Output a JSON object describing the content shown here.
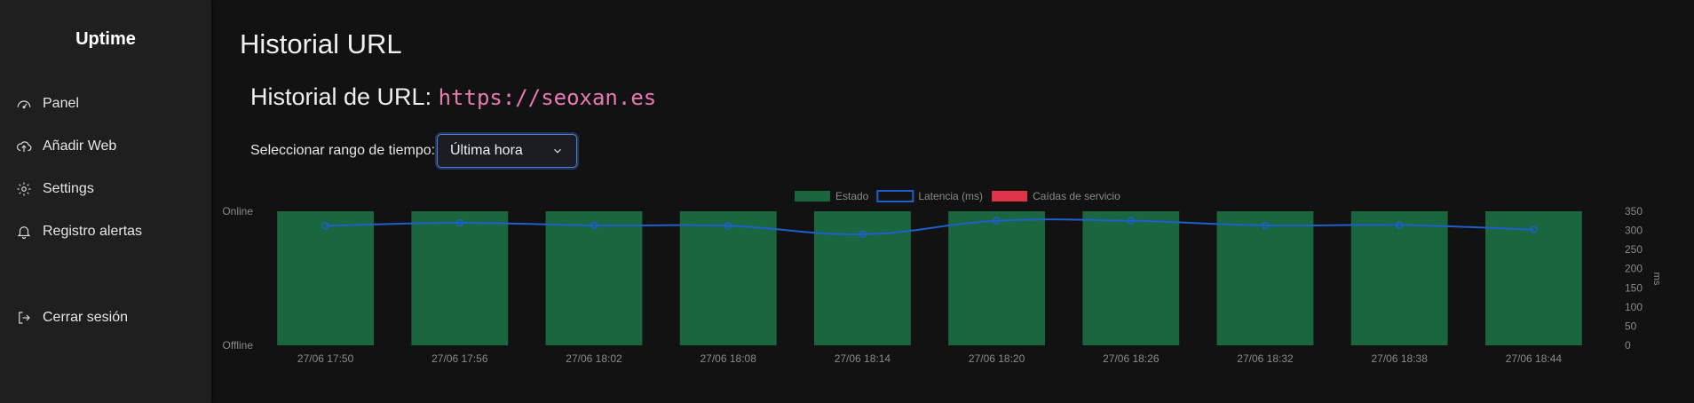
{
  "sidebar": {
    "brand": "Uptime",
    "items": [
      {
        "label": "Panel",
        "icon": "gauge-icon"
      },
      {
        "label": "Añadir Web",
        "icon": "cloud-upload-icon"
      },
      {
        "label": "Settings",
        "icon": "gear-icon"
      },
      {
        "label": "Registro alertas",
        "icon": "bell-icon"
      },
      {
        "label": "Cerrar sesión",
        "icon": "logout-icon"
      }
    ]
  },
  "main": {
    "title": "Historial URL",
    "subtitle_prefix": "Historial de URL:",
    "url": "https://seoxan.es",
    "range_label": "Seleccionar rango de tiempo:",
    "range_value": "Última hora"
  },
  "chart_data": {
    "type": "bar",
    "categories": [
      "27/06 17:50",
      "27/06 17:56",
      "27/06 18:02",
      "27/06 18:08",
      "27/06 18:14",
      "27/06 18:20",
      "27/06 18:26",
      "27/06 18:32",
      "27/06 18:38",
      "27/06 18:44"
    ],
    "series": [
      {
        "name": "Estado",
        "type": "bar",
        "values": [
          1,
          1,
          1,
          1,
          1,
          1,
          1,
          1,
          1,
          1
        ],
        "color": "#19663f"
      },
      {
        "name": "Latencia (ms)",
        "type": "line",
        "values": [
          312,
          320,
          313,
          312,
          290,
          325,
          325,
          313,
          314,
          302
        ],
        "color": "#1f5fcc"
      },
      {
        "name": "Caídas de servicio",
        "type": "bar",
        "values": [
          0,
          0,
          0,
          0,
          0,
          0,
          0,
          0,
          0,
          0
        ],
        "color": "#e0344a"
      }
    ],
    "y_left_ticks": [
      "Online",
      "Offline"
    ],
    "y_right_label": "ms",
    "y_right_ticks": [
      350,
      300,
      250,
      200,
      150,
      100,
      50,
      0
    ],
    "y_right_range": [
      0,
      350
    ],
    "legend_position": "top-center",
    "grid": false
  }
}
